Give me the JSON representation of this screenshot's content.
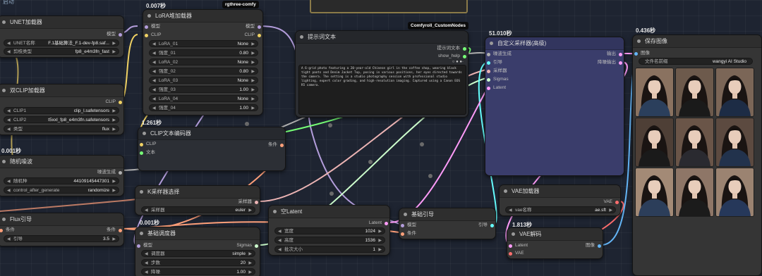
{
  "colors": {
    "model": "#b39ddb",
    "clip": "#f0d264",
    "conditioning": "#ffa07a",
    "latent": "#ff9cf9",
    "sampler": "#ecb4b4",
    "noise": "#b0b0b0",
    "sigmas": "#cdffcd",
    "image": "#64b5f6",
    "vae": "#ff6e6e",
    "guider": "#66ffff",
    "string": "#77ff77"
  },
  "top_partial_label": "启动",
  "unet_loader": {
    "title": "UNET加载器",
    "out_model": "模型",
    "unet_name_label": "UNET名称",
    "unet_name_value": "F.1基础算法_F.1-dev-fp8.saf...",
    "dtype_label": "剪枝类型",
    "dtype_value": "fp8_e4m3fn_fast"
  },
  "dual_clip": {
    "title": "双CLIP加载器",
    "out_clip": "CLIP",
    "clip1_label": "CLIP1",
    "clip1_value": "clip_l.safetensors",
    "clip2_label": "CLIP2",
    "clip2_value": "t5xxl_fp8_e4m3fn.safetensors",
    "type_label": "类型",
    "type_value": "flux"
  },
  "random_noise": {
    "timer": "0.001秒",
    "title": "随机噪波",
    "out_noise": "噪波生成",
    "seed_label": "随机种",
    "seed_value": "441091454473​01",
    "control_label": "control_after_generate",
    "control_value": "randomize"
  },
  "flux_guidance": {
    "title": "Flux引导",
    "in_cond": "条件",
    "out_cond": "条件",
    "guidance_label": "引导",
    "guidance_value": "3.5"
  },
  "lora_stack": {
    "timer": "0.007秒",
    "badge": "rgthree-comfy",
    "title": "LoRA堆加载器",
    "in_model": "模型",
    "in_clip": "CLIP",
    "out_model": "模型",
    "out_clip": "CLIP",
    "rows": [
      {
        "label": "LoRA_01",
        "value": "None"
      },
      {
        "label": "强度_01",
        "value": "0.80"
      },
      {
        "label": "LoRA_02",
        "value": "None"
      },
      {
        "label": "强度_02",
        "value": "0.80"
      },
      {
        "label": "LoRA_03",
        "value": "None"
      },
      {
        "label": "强度_03",
        "value": "1.00"
      },
      {
        "label": "LoRA_04",
        "value": "None"
      },
      {
        "label": "强度_04",
        "value": "1.00"
      }
    ]
  },
  "clip_encode": {
    "timer": "1.261秒",
    "title": "CLIP文本编码器",
    "in_clip": "CLIP",
    "in_text": "文本",
    "out_cond": "条件"
  },
  "ksampler_select": {
    "title": "K采样器选择",
    "out_sampler": "采样器",
    "sampler_label": "采样器",
    "sampler_value": "euler"
  },
  "basic_scheduler": {
    "timer": "0.001秒",
    "title": "基础调度器",
    "in_model": "模型",
    "out_sigmas": "Sigmas",
    "scheduler_label": "调度器",
    "scheduler_value": "simple",
    "steps_label": "步数",
    "steps_value": "20",
    "denoise_label": "降噪",
    "denoise_value": "1.00"
  },
  "prompt_text": {
    "badge": "Comfyroll_CustomNodes",
    "title": "提示词文本",
    "out_prompt": "提示词文本",
    "out_help": "show_help",
    "text": "A 6-grid photo featuring a 20-year-old Chinese girl in the coffee shop, wearing black tight pants and Denim Jacket Top, posing in various positions, her eyes directed towards the camera. The setting is a studio photography session with professional studio lighting, expert color grading, and high-resolution imaging. Captured using a Canon EOS R5 camera."
  },
  "empty_latent": {
    "title": "空Latent",
    "out_latent": "Latent",
    "width_label": "宽度",
    "width_value": "1024",
    "height_label": "高度",
    "height_value": "1536",
    "batch_label": "批次大小",
    "batch_value": "1"
  },
  "basic_guider": {
    "title": "基础引导",
    "in_model": "模型",
    "in_cond": "条件",
    "out_guider": "引导"
  },
  "custom_sampler": {
    "timer": "51.010秒",
    "title": "自定义采样器(高级)",
    "in_noise": "噪波生成",
    "in_guider": "引导",
    "in_sampler": "采样器",
    "in_sigmas": "Sigmas",
    "in_latent": "Latent",
    "out_output": "输出",
    "out_denoised": "降噪输出"
  },
  "vae_loader": {
    "title": "VAE加载器",
    "out_vae": "VAE",
    "vae_label": "vae名称",
    "vae_value": "ae.sft"
  },
  "vae_decode": {
    "timer": "1.813秒",
    "title": "VAE解码",
    "in_latent": "Latent",
    "in_vae": "VAE",
    "out_image": "图像"
  },
  "save_image": {
    "timer": "0.436秒",
    "title": "保存图像",
    "in_image": "图像",
    "prefix_label": "文件名前缀",
    "prefix_value": "wangyi AI Studio"
  }
}
